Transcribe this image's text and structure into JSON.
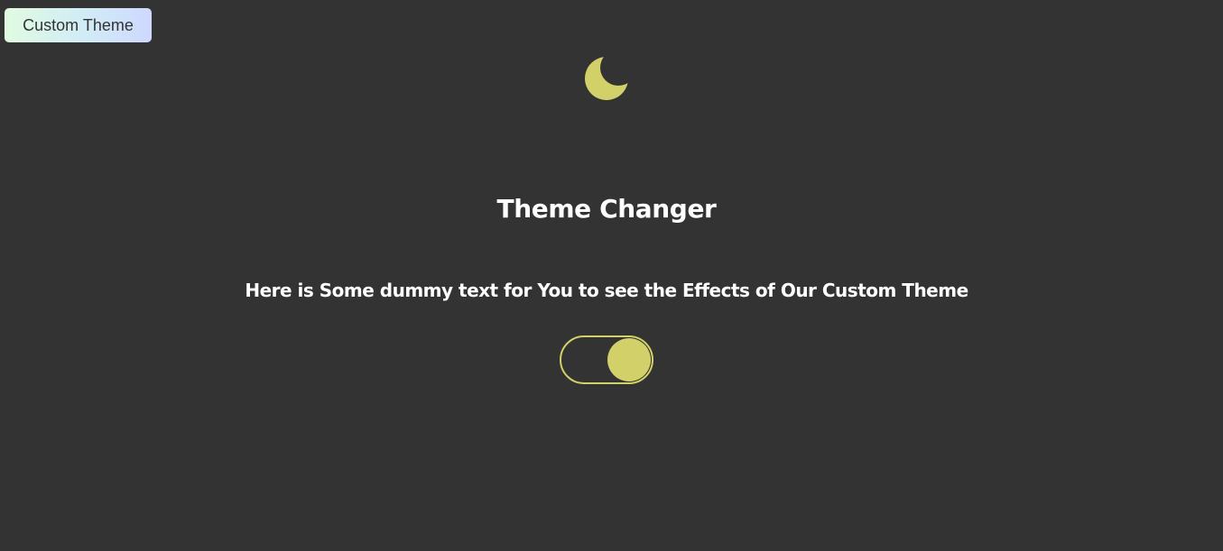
{
  "header": {
    "custom_theme_label": "Custom Theme"
  },
  "main": {
    "mode_icon": "moon-icon",
    "title": "Theme Changer",
    "dummy_text": "Here is Some dummy text for You to see the Effects of Our Custom Theme",
    "toggle": {
      "state": "on"
    }
  },
  "colors": {
    "background": "#333333",
    "accent": "#d2d068",
    "text": "#ffffff",
    "button_gradient": [
      "#e1fbe1",
      "#d0ecf6",
      "#cfd8ff"
    ]
  }
}
